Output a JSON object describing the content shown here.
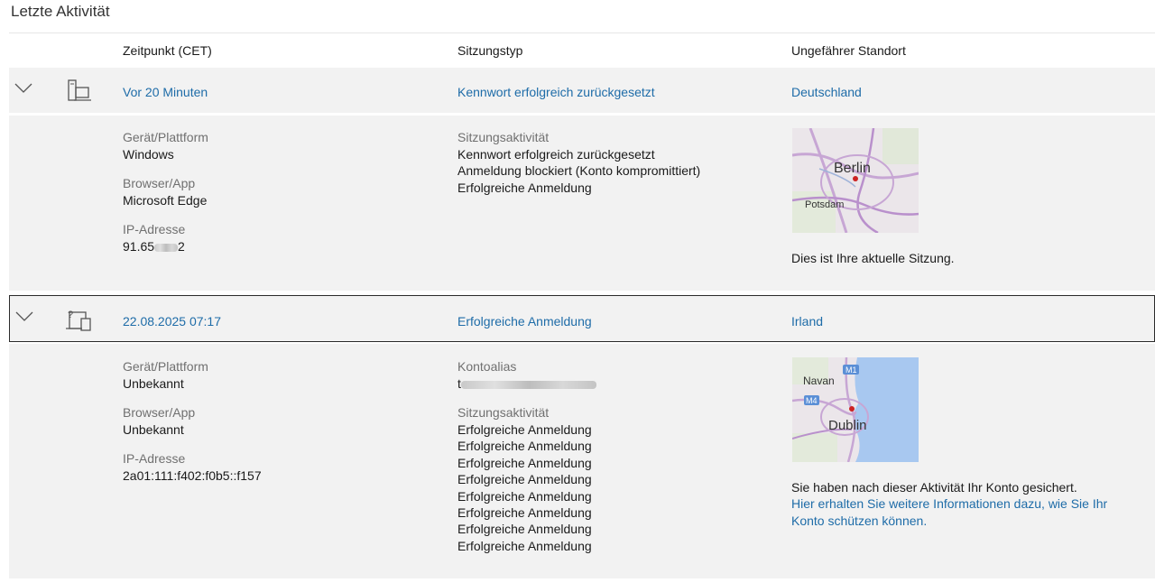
{
  "page": {
    "title": "Letzte Aktivität"
  },
  "columns": {
    "time": "Zeitpunkt (CET)",
    "session_type": "Sitzungstyp",
    "location": "Ungefährer Standort"
  },
  "sessions": [
    {
      "time": "Vor 20 Minuten",
      "type": "Kennwort erfolgreich zurückgesetzt",
      "location": "Deutschland",
      "device_icon": "computer-icon",
      "labels": {
        "device": "Gerät/Plattform",
        "browser": "Browser/App",
        "ip": "IP-Adresse",
        "activity": "Sitzungsaktivität"
      },
      "device": "Windows",
      "browser": "Microsoft Edge",
      "ip_visible_start": "91.65",
      "ip_visible_end": "2",
      "activities": [
        "Kennwort erfolgreich zurückgesetzt",
        "Anmeldung blockiert (Konto kompromittiert)",
        "Erfolgreiche Anmeldung"
      ],
      "map": {
        "city": "Berlin",
        "secondary": "Potsdam"
      },
      "note": "Dies ist Ihre aktuelle Sitzung."
    },
    {
      "time": "22.08.2025 07:17",
      "type": "Erfolgreiche Anmeldung",
      "location": "Irland",
      "device_icon": "unknown-device-icon",
      "labels": {
        "device": "Gerät/Plattform",
        "browser": "Browser/App",
        "ip": "IP-Adresse",
        "alias": "Kontoalias",
        "activity": "Sitzungsaktivität"
      },
      "device": "Unbekannt",
      "browser": "Unbekannt",
      "ip": "2a01:111:f402:f0b5::f157",
      "alias_visible_start": "t",
      "activities": [
        "Erfolgreiche Anmeldung",
        "Erfolgreiche Anmeldung",
        "Erfolgreiche Anmeldung",
        "Erfolgreiche Anmeldung",
        "Erfolgreiche Anmeldung",
        "Erfolgreiche Anmeldung",
        "Erfolgreiche Anmeldung",
        "Erfolgreiche Anmeldung"
      ],
      "map": {
        "city": "Dublin",
        "secondary": "Navan",
        "road1": "M1",
        "road2": "M4"
      },
      "note": "Sie haben nach dieser Aktivität Ihr Konto gesichert.",
      "link": "Hier erhalten Sie weitere Informationen dazu, wie Sie Ihr Konto schützen können."
    }
  ],
  "colors": {
    "link": "#1e6ca8",
    "row_bg": "#f2f2f2",
    "label": "#707070",
    "water": "#a8c8f0"
  }
}
